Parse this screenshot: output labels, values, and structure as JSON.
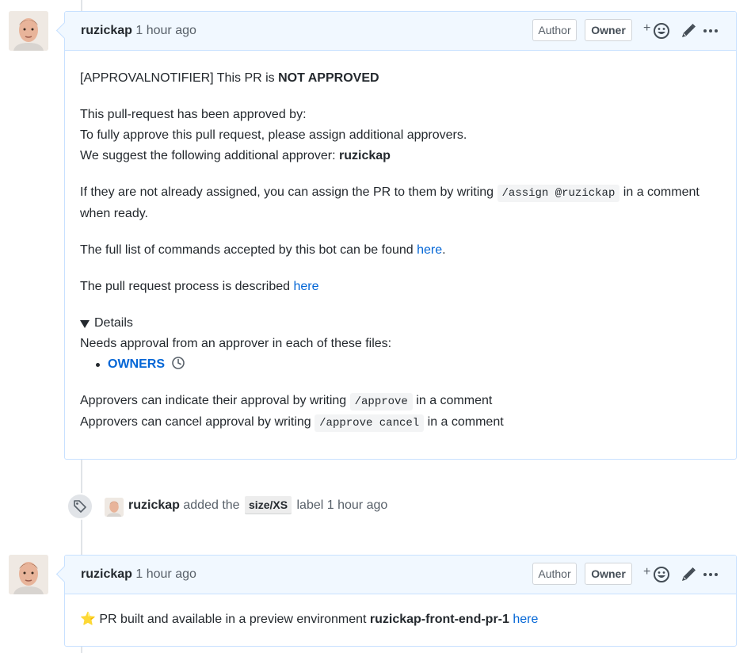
{
  "comments": [
    {
      "author": "ruzickap",
      "timestamp": "1 hour ago",
      "author_label": "Author",
      "owner_label": "Owner",
      "reaction_plus": "+",
      "body": {
        "notifier_prefix": "[APPROVALNOTIFIER] This PR is ",
        "notifier_status": "NOT APPROVED",
        "approved_by": "This pull-request has been approved by:",
        "fully_approve": "To fully approve this pull request, please assign additional approvers.",
        "suggest_prefix": "We suggest the following additional approver: ",
        "suggest_name": "ruzickap",
        "assign_prefix": "If they are not already assigned, you can assign the PR to them by writing ",
        "assign_code": "/assign @ruzickap",
        "assign_suffix": " in a comment when ready.",
        "commands_prefix": "The full list of commands accepted by this bot can be found ",
        "commands_link": "here",
        "commands_suffix": ".",
        "process_prefix": "The pull request process is described ",
        "process_link": "here",
        "details_summary": "Details",
        "details_text": "Needs approval from an approver in each of these files:",
        "owners_link": "OWNERS",
        "approve_prefix": "Approvers can indicate their approval by writing ",
        "approve_code": "/approve",
        "approve_suffix": " in a comment",
        "cancel_prefix": "Approvers can cancel approval by writing ",
        "cancel_code": "/approve cancel",
        "cancel_suffix": " in a comment"
      }
    },
    {
      "author": "ruzickap",
      "timestamp": "1 hour ago",
      "author_label": "Author",
      "owner_label": "Owner",
      "reaction_plus": "+",
      "body": {
        "star": "⭐",
        "text_prefix": " PR built and available in a preview environment ",
        "env_name": "ruzickap-front-end-pr-1",
        "link": "here"
      }
    }
  ],
  "event": {
    "actor": "ruzickap",
    "action": "added the",
    "label": "size/XS",
    "suffix": "label",
    "timestamp": "1 hour ago"
  },
  "colors": {
    "link": "#0366d6",
    "header_bg": "#f1f8ff",
    "header_border": "#c8e1ff"
  },
  "icons": [
    "smiley-icon",
    "pencil-icon",
    "kebab-horizontal-icon",
    "tag-icon",
    "clock-icon"
  ]
}
